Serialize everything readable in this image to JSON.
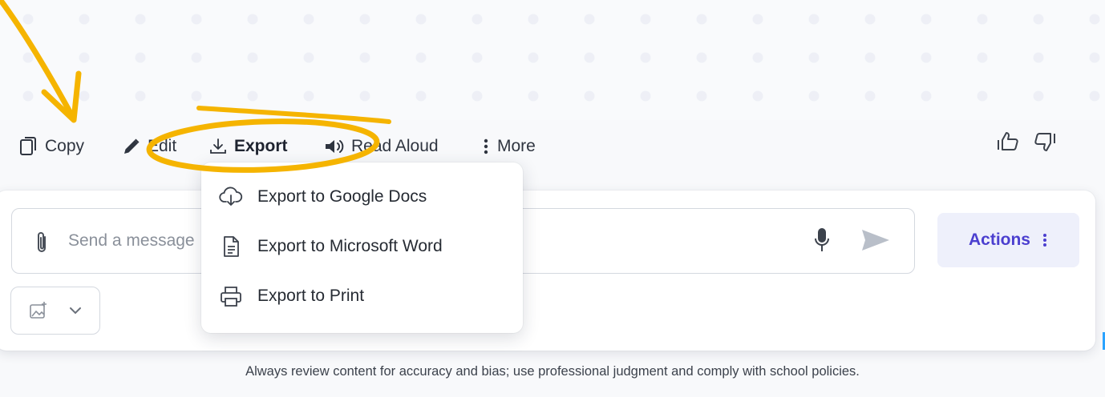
{
  "toolbar": {
    "copy_label": "Copy",
    "edit_label": "Edit",
    "export_label": "Export",
    "read_aloud_label": "Read Aloud",
    "more_label": "More"
  },
  "export_menu": {
    "items": [
      {
        "label": "Export to Google Docs",
        "icon": "cloud-download-icon"
      },
      {
        "label": "Export to Microsoft Word",
        "icon": "document-icon"
      },
      {
        "label": "Export to Print",
        "icon": "printer-icon"
      }
    ]
  },
  "composer": {
    "placeholder": "Send a message",
    "actions_label": "Actions"
  },
  "disclaimer": "Always review content for accuracy and bias; use professional judgment and comply with school policies.",
  "colors": {
    "accent": "#4b3fcf",
    "annotation": "#f5b400",
    "text": "#2f3540"
  }
}
